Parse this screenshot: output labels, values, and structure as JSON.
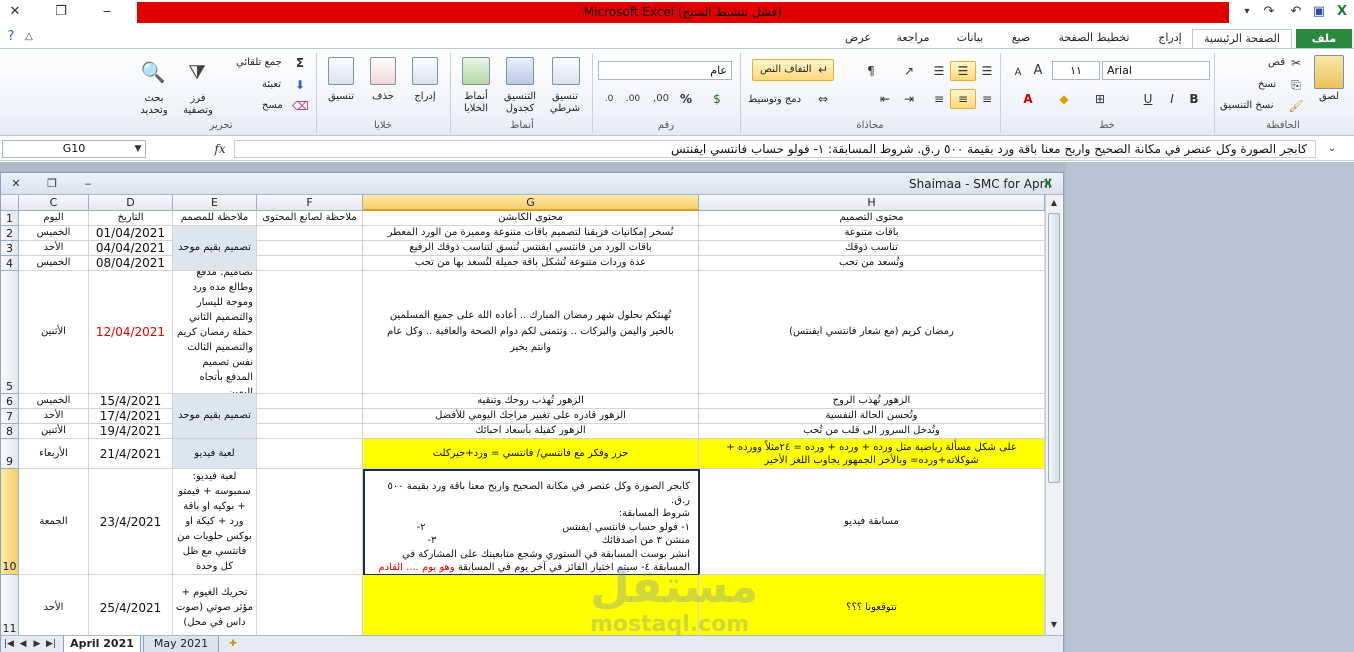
{
  "window": {
    "title": "Microsoft Excel (فشل تنشيط المنتج)"
  },
  "tabs": [
    "ملف",
    "الصفحة الرئيسية",
    "إدراج",
    "تخطيط الصفحة",
    "صيغ",
    "بيانات",
    "مراجعة",
    "عرض"
  ],
  "ribbon": {
    "clipboard": {
      "label": "الحافظة",
      "paste": "لصق",
      "cut": "قص",
      "copy": "نسخ",
      "format_painter": "نسخ التنسيق"
    },
    "font": {
      "label": "خط",
      "name": "Arial",
      "size": "١١",
      "bold": "B",
      "italic": "I",
      "underline": "U"
    },
    "alignment": {
      "label": "محاذاة",
      "wrap": "التفاف النص",
      "merge": "دمج وتوسيط"
    },
    "number": {
      "label": "رقم",
      "format": "عام",
      "percent": "%"
    },
    "styles": {
      "label": "أنماط",
      "conditional": "تنسيق شرطي",
      "table": "التنسيق كجدول",
      "cell": "أنماط الخلايا"
    },
    "cells": {
      "label": "خلايا",
      "insert": "إدراج",
      "delete": "حذف",
      "format": "تنسيق"
    },
    "editing": {
      "label": "تحرير",
      "autosum": "جمع تلقائي",
      "fill": "تعبئة",
      "clear": "مسح",
      "sort": "فرز وتصفية",
      "find": "بحث وتحديد"
    }
  },
  "formula_bar": {
    "name_box": "G10",
    "fx": "fx",
    "content": "كابجر الصورة وكل عنصر في مكانة الصحيح واربح معنا باقة ورد بقيمة ٥٠٠ ر.ق.  شروط المسابقة:                                               ١- فولو حساب فانتسي ايفنتس"
  },
  "workbook": {
    "title": "Shaimaa - SMC for April"
  },
  "columns": [
    "C",
    "D",
    "E",
    "F",
    "G",
    "H"
  ],
  "rows": [
    "1",
    "2",
    "3",
    "4",
    "5",
    "6",
    "7",
    "8",
    "9",
    "10",
    "11"
  ],
  "cells": {
    "C1": "اليوم",
    "D1": "التاريخ",
    "E1": "ملاحظة للمصمم",
    "F1": "ملاحظة لصانع المحتوى",
    "G1": "محتوى الكابشن",
    "H1": "محتوى التصميم",
    "C2": "الخميس",
    "D2": "01/04/2021",
    "G2": "نُسخر إمكانيات فريقنا لتصميم باقات متنوعة ومميزة من الورد المعطر",
    "H2": "باقات متنوعة",
    "C3": "الأحد",
    "D3": "04/04/2021",
    "E3": "تصميم بقيم موحد",
    "G3": "باقات الورد من فانتسي ايفنتس تُنسق لتناسب ذوقك الرفيع",
    "H3": "تناسب ذوقك",
    "C4": "الخميس",
    "D4": "08/04/2021",
    "G4": "عدة وردات متنوعة تُشكل باقة جميلة لتُسعد بها من تحب",
    "H4": "وتُسعد من تحب",
    "C5": "الأثنين",
    "D5": "12/04/2021",
    "E5": "تصاميم: مدفع وطالع مده ورد وموجة لليسار والتصميم الثاني حملة رمضان كريم والتصميم الثالث نفس تصميم المدفع بأتجاه اليمين.",
    "G5": "تُهنئكم بحلول شهر رمضان المبارك .. أعاده الله على جميع المسلمين بالخير واليمن والبركات .. وتتمنى لكم دوام الصحة والعافية .. وكل عام وانتم بخير",
    "H5": "رمضان كريم (مع شعار فانتسي ايفنتس)",
    "C6": "الخميس",
    "D6": "15/4/2021",
    "G6": "الزهور تُهذب روحك وتنقيه",
    "H6": "الزهور تُهذب الروح",
    "C7": "الأحد",
    "D7": "17/4/2021",
    "E7": "تصميم بقيم موحد",
    "G7": "الزهور قادره على تغيير مزاجك اليومي للأفضل",
    "H7": "وتُحسن الحالة النفسية",
    "C8": "الأثنين",
    "D8": "19/4/2021",
    "G8": "الزهور كفيلة بأسعاد احبائك",
    "H8": "وتُدخل السرور الى قلب من تُحب",
    "C9": "الأربعاء",
    "D9": "21/4/2021",
    "E9": "لعبة فيديو",
    "G9": "حزر وفكر مع فانتسي/ فانتسي = ورد+جيركلت",
    "H9": "على شكل مسألة رياضية مثل ورده + ورده + ورده = ٢٤مثلاً وورده + شوكلاته+ورده= وبالأخر الجمهور يجاوب اللغز الأخير",
    "C10": "الجمعة",
    "D10": "23/4/2021",
    "E10": "لعبة فيديو: سمبوسه + فيمتو + بوكيه او باقة ورد + كيكة او بوكس حلويات من فانتسي مع ظل كل وحدة",
    "H10": "مسابقة فيديو",
    "G10_lines": [
      "كابجر الصورة وكل عنصر في مكانة الصحيح واربح معنا باقة ورد بقيمة ٥٠٠ ر.ق.",
      "شروط المسابقة:",
      "١- فولو حساب فانتسي ايفنتس                                           ٢-",
      "منشن ٣ من اصدقائك                                                    ٣-",
      "انشر بوست المسابقة في الستوري وشجع متابعينك على المشاركة في المسابقة ٤- سيتم اختيار الفائز في آخر يوم في المسابقة"
    ],
    "G10_red": "وهو يوم .... القادم الموافق ....",
    "C11": "الأحد",
    "D11": "25/4/2021",
    "E11": "تحريك الغيوم + مؤثر صوتي (صوت داس في محل)",
    "H11": "تتوقعونا ؟؟؟"
  },
  "sheets": [
    "April 2021",
    "May 2021"
  ],
  "watermark": {
    "arabic": "مستقل",
    "latin": "mostaql.com"
  }
}
